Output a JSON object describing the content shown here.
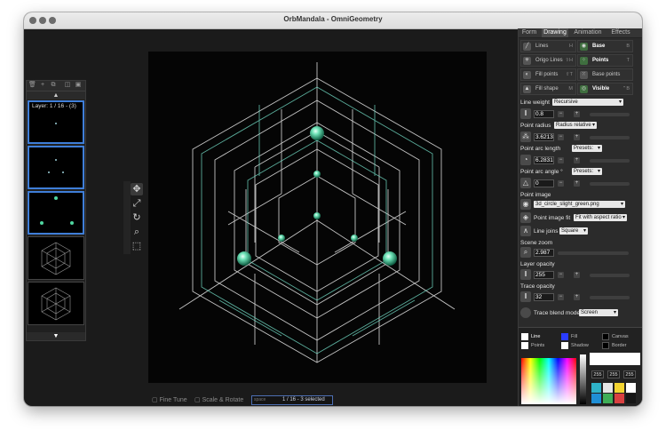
{
  "window": {
    "title": "OrbMandala - OmniGeometry"
  },
  "layers": {
    "layer_label": "Layer: 1 / 16 - (3)",
    "scroll_up": "▲",
    "scroll_down": "▼",
    "toolbar_icons": [
      "trash-icon",
      "add-icon",
      "duplicate-icon",
      "merge-icon",
      "group-icon"
    ]
  },
  "tools": [
    "move-icon",
    "fit-icon",
    "rotate-icon",
    "zoom-icon",
    "marquee-icon"
  ],
  "bottom_bar": {
    "fine_tune": "Fine Tune",
    "scale_rotate": "Scale & Rotate",
    "space_hint": "space",
    "status": "1 / 16 - 3 selected"
  },
  "panel": {
    "tabs": [
      "Form",
      "Drawing",
      "Animation",
      "Effects"
    ],
    "active_tab": "Drawing",
    "toggles": [
      {
        "label": "Lines",
        "key": "H",
        "on": false
      },
      {
        "label": "Base",
        "key": "B",
        "on": true
      },
      {
        "label": "Origo Lines",
        "key": "⇧H",
        "on": false
      },
      {
        "label": "Points",
        "key": "T",
        "on": true
      },
      {
        "label": "Fill points",
        "key": "⇧T",
        "on": false
      },
      {
        "label": "Base points",
        "key": "",
        "on": false
      },
      {
        "label": "Fill shape",
        "key": "M",
        "on": false
      },
      {
        "label": "Visible",
        "key": "⌃B",
        "on": true
      }
    ],
    "line_weight": {
      "label": "Line weight",
      "mode": "Recursive",
      "value": "0.8"
    },
    "point_radius": {
      "label": "Point radius",
      "mode": "Radius relative",
      "value": "3.6213"
    },
    "point_arc_length": {
      "label": "Point arc length",
      "presets": "Presets:",
      "value": "6.2831"
    },
    "point_arc_angle": {
      "label": "Point arc angle °",
      "presets": "Presets:",
      "value": "0"
    },
    "point_image": {
      "label": "Point image",
      "file": "3d_circle_slight_green.png"
    },
    "point_image_fit": {
      "label": "Point image fit",
      "mode": "Fit with aspect ratio"
    },
    "line_joins": {
      "label": "Line joins",
      "mode": "Square"
    },
    "scene_zoom": {
      "label": "Scene zoom",
      "value": "2.987"
    },
    "layer_opacity": {
      "label": "Layer opacity",
      "value": "255"
    },
    "trace_opacity": {
      "label": "Trace opacity",
      "value": "32"
    },
    "trace_blend": {
      "label": "Trace blend mode",
      "mode": "Screen"
    }
  },
  "colors": {
    "targets": [
      {
        "label": "Line",
        "color": "#ffffff"
      },
      {
        "label": "Fill",
        "color": "#2a3cff"
      },
      {
        "label": "Canvas",
        "color": "#000000"
      },
      {
        "label": "Points",
        "color": "#ffffff"
      },
      {
        "label": "Shadow",
        "color": "#ffffff"
      },
      {
        "label": "Border",
        "color": "#000000"
      }
    ],
    "rgb": [
      "255",
      "255",
      "255"
    ],
    "history": [
      "#2fb3c8",
      "#e6e6e6",
      "#f3d431",
      "#ffffff",
      "#1f8fd6",
      "#3fae57",
      "#d94040",
      "#161616"
    ],
    "accent": "#3f7ed8"
  }
}
